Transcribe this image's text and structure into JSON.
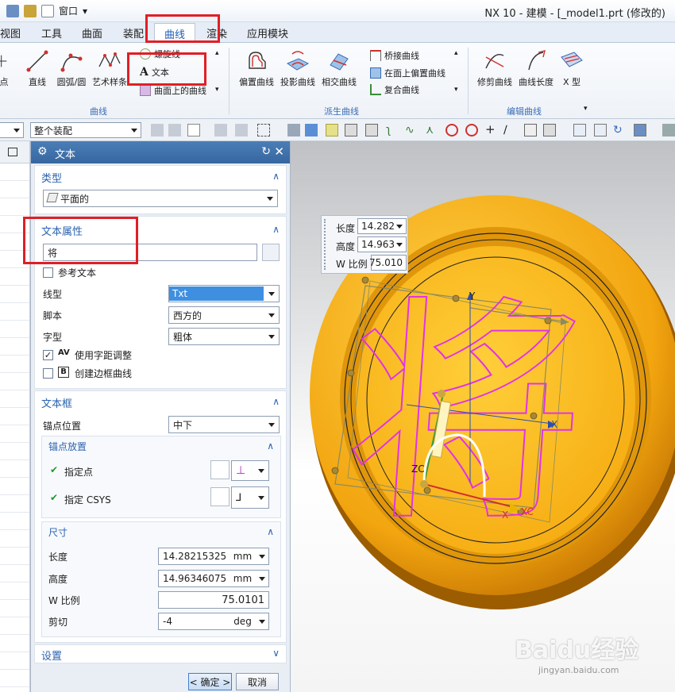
{
  "app": {
    "window_title": "NX 10 - 建模 - [_model1.prt  (修改的)",
    "quick_menu": "窗口"
  },
  "menu_tabs": [
    "视图",
    "工具",
    "曲面",
    "装配",
    "曲线",
    "渲染",
    "应用模块"
  ],
  "ribbon": {
    "left_group": {
      "buttons": [
        "点",
        "直线",
        "圆弧/圆",
        "艺术样条"
      ],
      "stack": [
        "螺旋线",
        "文本",
        "曲面上的曲线"
      ],
      "group_label": "曲线"
    },
    "derived_group": {
      "buttons": [
        "偏置曲线",
        "投影曲线",
        "相交曲线"
      ],
      "stack": [
        "桥接曲线",
        "在面上偏置曲线",
        "复合曲线"
      ],
      "group_label": "派生曲线"
    },
    "edit_group": {
      "buttons": [
        "修剪曲线",
        "曲线长度",
        "X 型"
      ],
      "group_label": "编辑曲线"
    }
  },
  "toolbar": {
    "selection_filter": "整个装配"
  },
  "dialog": {
    "title": "文本",
    "type_section": {
      "label": "类型",
      "value": "平面的"
    },
    "text_props_section": {
      "label": "文本属性",
      "text_value": "将",
      "ref_text_label": "参考文本",
      "rows": [
        {
          "label": "线型",
          "value": "Txt"
        },
        {
          "label": "脚本",
          "value": "西方的"
        },
        {
          "label": "字型",
          "value": "粗体"
        }
      ],
      "kerning_label": "使用字距调整",
      "kerning_checked": true,
      "frame_curve_label": "创建边框曲线",
      "frame_curve_checked": false
    },
    "text_frame_section": {
      "label": "文本框",
      "anchor_pos_label": "锚点位置",
      "anchor_pos_value": "中下",
      "anchor_place": {
        "label": "锚点放置",
        "specify_point": "指定点",
        "specify_csys": "指定 CSYS"
      },
      "size": {
        "label": "尺寸",
        "length_label": "长度",
        "length_value": "14.28215325(",
        "height_label": "高度",
        "height_value": "14.96346075:",
        "unit": "mm",
        "w_scale_label": "W 比例",
        "w_scale_value": "75.0101",
        "shear_label": "剪切",
        "shear_value": "-4",
        "shear_unit": "deg"
      }
    },
    "settings_label": "设置",
    "ok_label": "< 确定 >",
    "cancel_label": "取消"
  },
  "viewport": {
    "popup": {
      "length_label": "长度",
      "length_value": "14.282",
      "height_label": "高度",
      "height_value": "14.963",
      "w_label": "W 比例",
      "w_value": "75.010"
    },
    "text_glyph": "将",
    "axis_labels": {
      "x": "X",
      "y": "Y",
      "xc": "XC",
      "zc": "ZC"
    },
    "watermark": "Baidu经验",
    "watermark_sub": "jingyan.baidu.com",
    "colors": {
      "coin": "#f7b518",
      "text_curve": "#e033e6",
      "accent": "#2c63b0",
      "highlight_box": "#e01f26"
    }
  }
}
